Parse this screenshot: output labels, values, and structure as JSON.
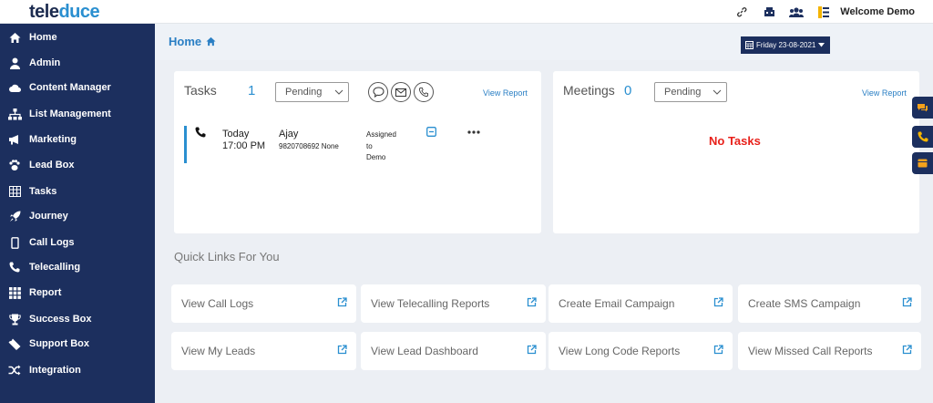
{
  "brand": {
    "part1": "tele",
    "part2": "duce"
  },
  "topbar": {
    "welcome": "Welcome Demo"
  },
  "sidebar": {
    "items": [
      {
        "label": "Home",
        "icon": "home-icon"
      },
      {
        "label": "Admin",
        "icon": "user-icon"
      },
      {
        "label": "Content Manager",
        "icon": "cloud-icon"
      },
      {
        "label": "List Management",
        "icon": "sitemap-icon"
      },
      {
        "label": "Marketing",
        "icon": "megaphone-icon"
      },
      {
        "label": "Lead Box",
        "icon": "paw-icon"
      },
      {
        "label": "Tasks",
        "icon": "table-icon"
      },
      {
        "label": "Journey",
        "icon": "rocket-icon"
      },
      {
        "label": "Call Logs",
        "icon": "mobile-icon"
      },
      {
        "label": "Telecalling",
        "icon": "phone-icon"
      },
      {
        "label": "Report",
        "icon": "grid-icon"
      },
      {
        "label": "Success Box",
        "icon": "trophy-icon"
      },
      {
        "label": "Support Box",
        "icon": "ticket-icon"
      },
      {
        "label": "Integration",
        "icon": "shuffle-icon"
      }
    ]
  },
  "header": {
    "breadcrumb": "Home",
    "date": "Friday 23-08-2021"
  },
  "tasks": {
    "title": "Tasks",
    "count": "1",
    "filter": "Pending",
    "view_report": "View Report",
    "item": {
      "day": "Today",
      "time": "17:00 PM",
      "name": "Ajay",
      "phone": "9820708692 None",
      "assigned_1": "Assigned",
      "assigned_2": "to",
      "assigned_3": "Demo"
    }
  },
  "meetings": {
    "title": "Meetings",
    "count": "0",
    "filter": "Pending",
    "view_report": "View Report",
    "empty": "No Tasks"
  },
  "quick_links": {
    "title": "Quick Links For You",
    "items": [
      "View Call Logs",
      "View Telecalling Reports",
      "Create Email Campaign",
      "Create SMS Campaign",
      "View My Leads",
      "View Lead Dashboard",
      "View Long Code Reports",
      "View Missed Call Reports"
    ]
  },
  "colors": {
    "sidebar": "#1c2f5e",
    "accent": "#2a8fd0",
    "danger": "#e8211b"
  }
}
